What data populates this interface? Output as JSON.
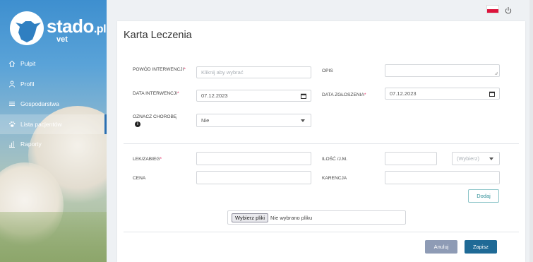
{
  "brand": {
    "name": "stado",
    "tld": ".pl",
    "sub": "vet"
  },
  "nav": [
    {
      "label": "Pulpit",
      "icon": "home-icon"
    },
    {
      "label": "Profil",
      "icon": "user-icon"
    },
    {
      "label": "Gospodarstwa",
      "icon": "list-icon"
    },
    {
      "label": "Lista pacjentów",
      "icon": "paw-icon",
      "active": true
    },
    {
      "label": "Raporty",
      "icon": "bar-chart-icon"
    }
  ],
  "page": {
    "title": "Karta Leczenia"
  },
  "form": {
    "powod_label": "POWÓD INTERWENCJI",
    "powod_placeholder": "Kliknij aby wybrać",
    "opis_label": "OPIS",
    "data_interwencji_label": "DATA INTERWENCJI",
    "data_interwencji_value": "07.12.2023",
    "data_zgloszenia_label": "DATA ZGŁOSZENIA",
    "data_zgloszenia_value": "07.12.2023",
    "oznacz_label": "OZNACZ CHOROBĘ",
    "oznacz_value": "Nie",
    "lek_label": "LEK/ZABIEG",
    "ilosc_label": "ILOŚĆ /J.M.",
    "jm_placeholder": "(Wybierz)",
    "cena_label": "CENA",
    "karencja_label": "KARENCJA",
    "dodaj_label": "Dodaj",
    "file_button": "Wybierz pliki",
    "file_status": "Nie wybrano pliku",
    "anuluj_label": "Anuluj",
    "zapisz_label": "Zapisz",
    "required_mark": "*"
  },
  "colors": {
    "primary": "#1f6a96",
    "secondary": "#8e9bb5",
    "accent": "#2f8f98",
    "required": "#e0245e"
  }
}
